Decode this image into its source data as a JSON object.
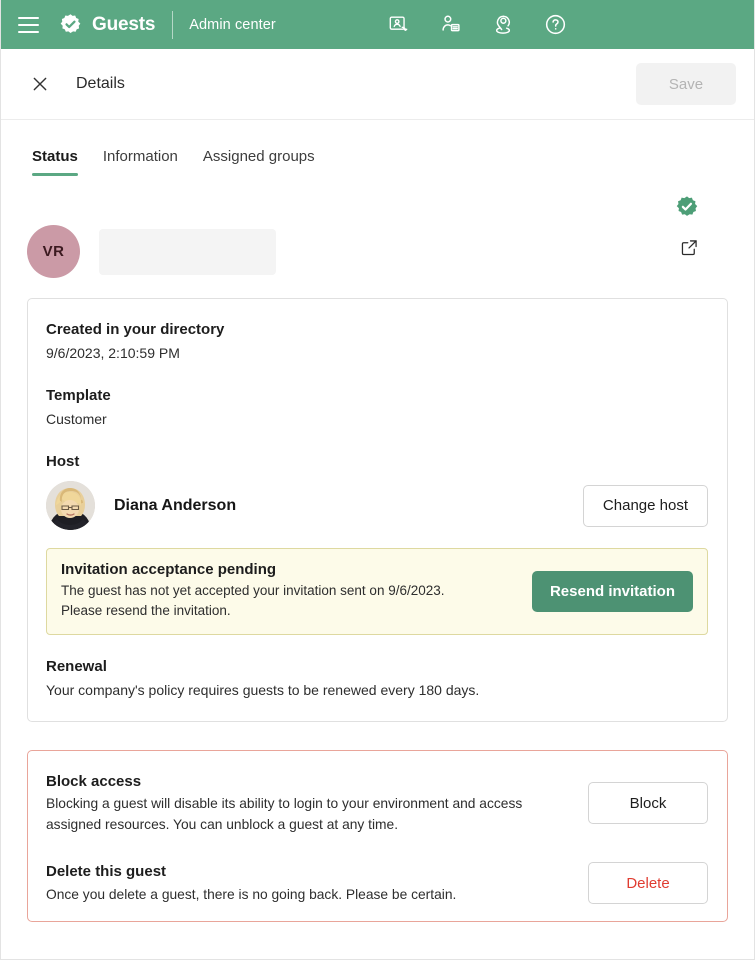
{
  "appbar": {
    "menu_icon": "hamburger-icon",
    "logo_icon": "verified-badge-logo",
    "brand": "Guests",
    "subtitle": "Admin center",
    "icons": [
      {
        "name": "guest-card-icon",
        "label": "Guests directory"
      },
      {
        "name": "user-list-icon",
        "label": "Users"
      },
      {
        "name": "user-locate-icon",
        "label": "Locate"
      },
      {
        "name": "help-icon",
        "label": "Help"
      }
    ],
    "background": "#5ba883"
  },
  "detailbar": {
    "close_icon": "close-icon",
    "title": "Details",
    "save_label": "Save"
  },
  "tabs": [
    {
      "label": "Status",
      "active": true
    },
    {
      "label": "Information",
      "active": false
    },
    {
      "label": "Assigned groups",
      "active": false
    }
  ],
  "identity": {
    "avatar_initials": "VR",
    "avatar_color": "#cb9aa6",
    "verified_icon": "verified-check-badge",
    "open_external_icon": "open-external-icon",
    "name_value": ""
  },
  "status_card": {
    "created": {
      "title": "Created in your directory",
      "value": "9/6/2023, 2:10:59 PM"
    },
    "template": {
      "title": "Template",
      "value": "Customer"
    },
    "host": {
      "title": "Host",
      "name": "Diana Anderson",
      "change_label": "Change host",
      "avatar_icon": "host-photo-avatar"
    },
    "warning": {
      "title": "Invitation acceptance pending",
      "body_line1": "The guest has not yet accepted your invitation sent on 9/6/2023.",
      "body_line2": "Please resend the invitation.",
      "action_label": "Resend invitation",
      "accent": "#4d9273",
      "background": "#fdfbe9",
      "border": "#ded9a0"
    },
    "renewal": {
      "title": "Renewal",
      "body": "Your company's policy requires guests to be renewed every 180 days."
    }
  },
  "danger_card": {
    "border_color": "#e9a59a",
    "block": {
      "title": "Block access",
      "body": "Blocking a guest will disable its ability to login to your environment and access assigned resources. You can unblock a guest at any time.",
      "action_label": "Block"
    },
    "delete": {
      "title": "Delete this guest",
      "body": "Once you delete a guest, there is no going back. Please be certain.",
      "action_label": "Delete",
      "action_color": "#e03c31"
    }
  }
}
